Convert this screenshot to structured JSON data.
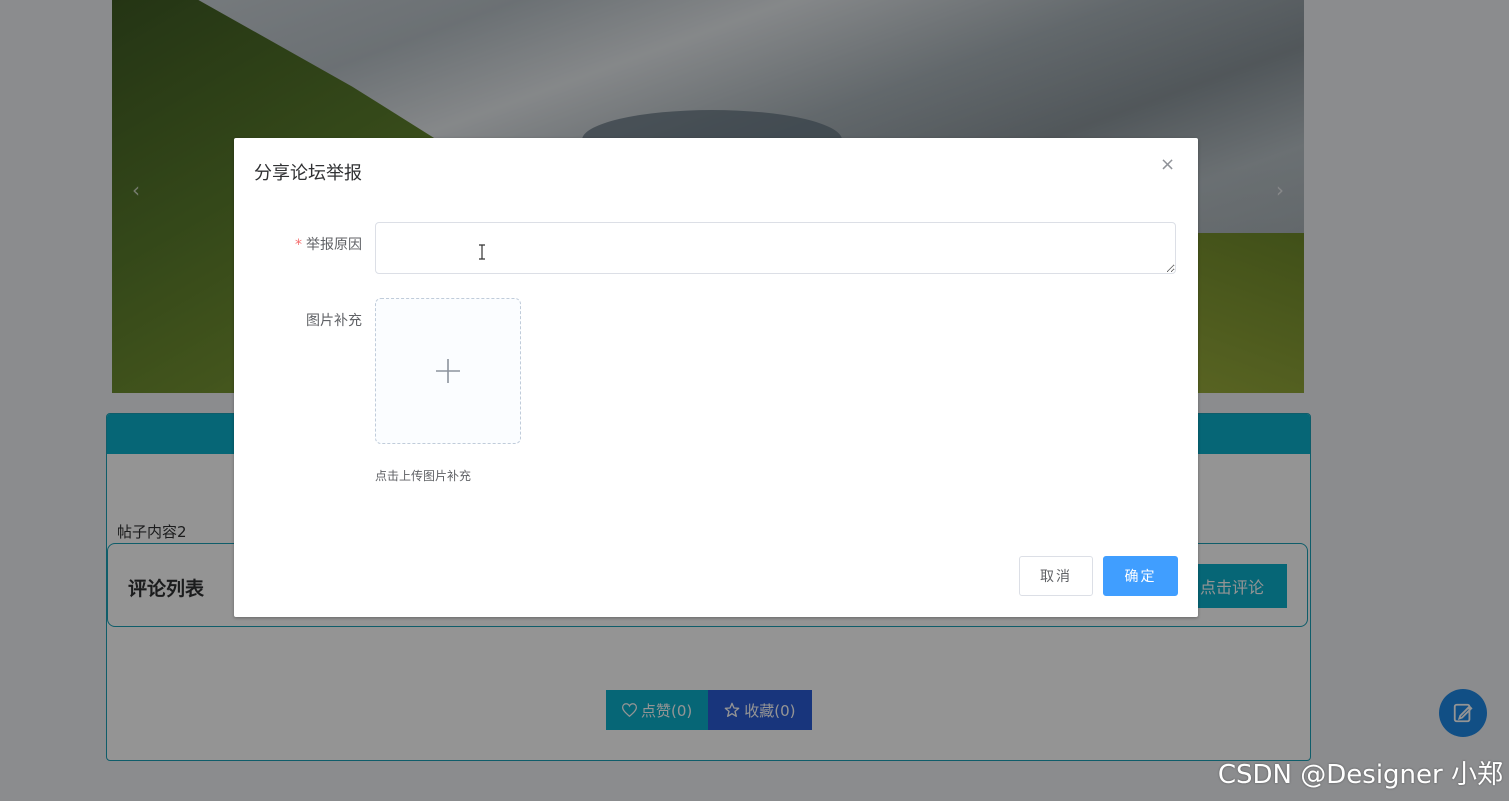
{
  "page": {
    "post_content": "帖子内容2",
    "comments_title": "评论列表",
    "comment_button": "点击评论",
    "like_button": "点赞(0)",
    "favorite_button": "收藏(0)",
    "carousel_prev": "‹",
    "carousel_next": "›"
  },
  "dialog": {
    "title": "分享论坛举报",
    "close_glyph": "×",
    "reason_label": "举报原因",
    "reason_required_mark": "*",
    "reason_value": "",
    "image_label": "图片补充",
    "upload_tip": "点击上传图片补充",
    "cancel_label": "取消",
    "confirm_label": "确定"
  },
  "watermark": "CSDN @Designer 小郑",
  "colors": {
    "primary": "#409eff",
    "teal": "#0bb0cc",
    "blue": "#2a5cd6"
  }
}
